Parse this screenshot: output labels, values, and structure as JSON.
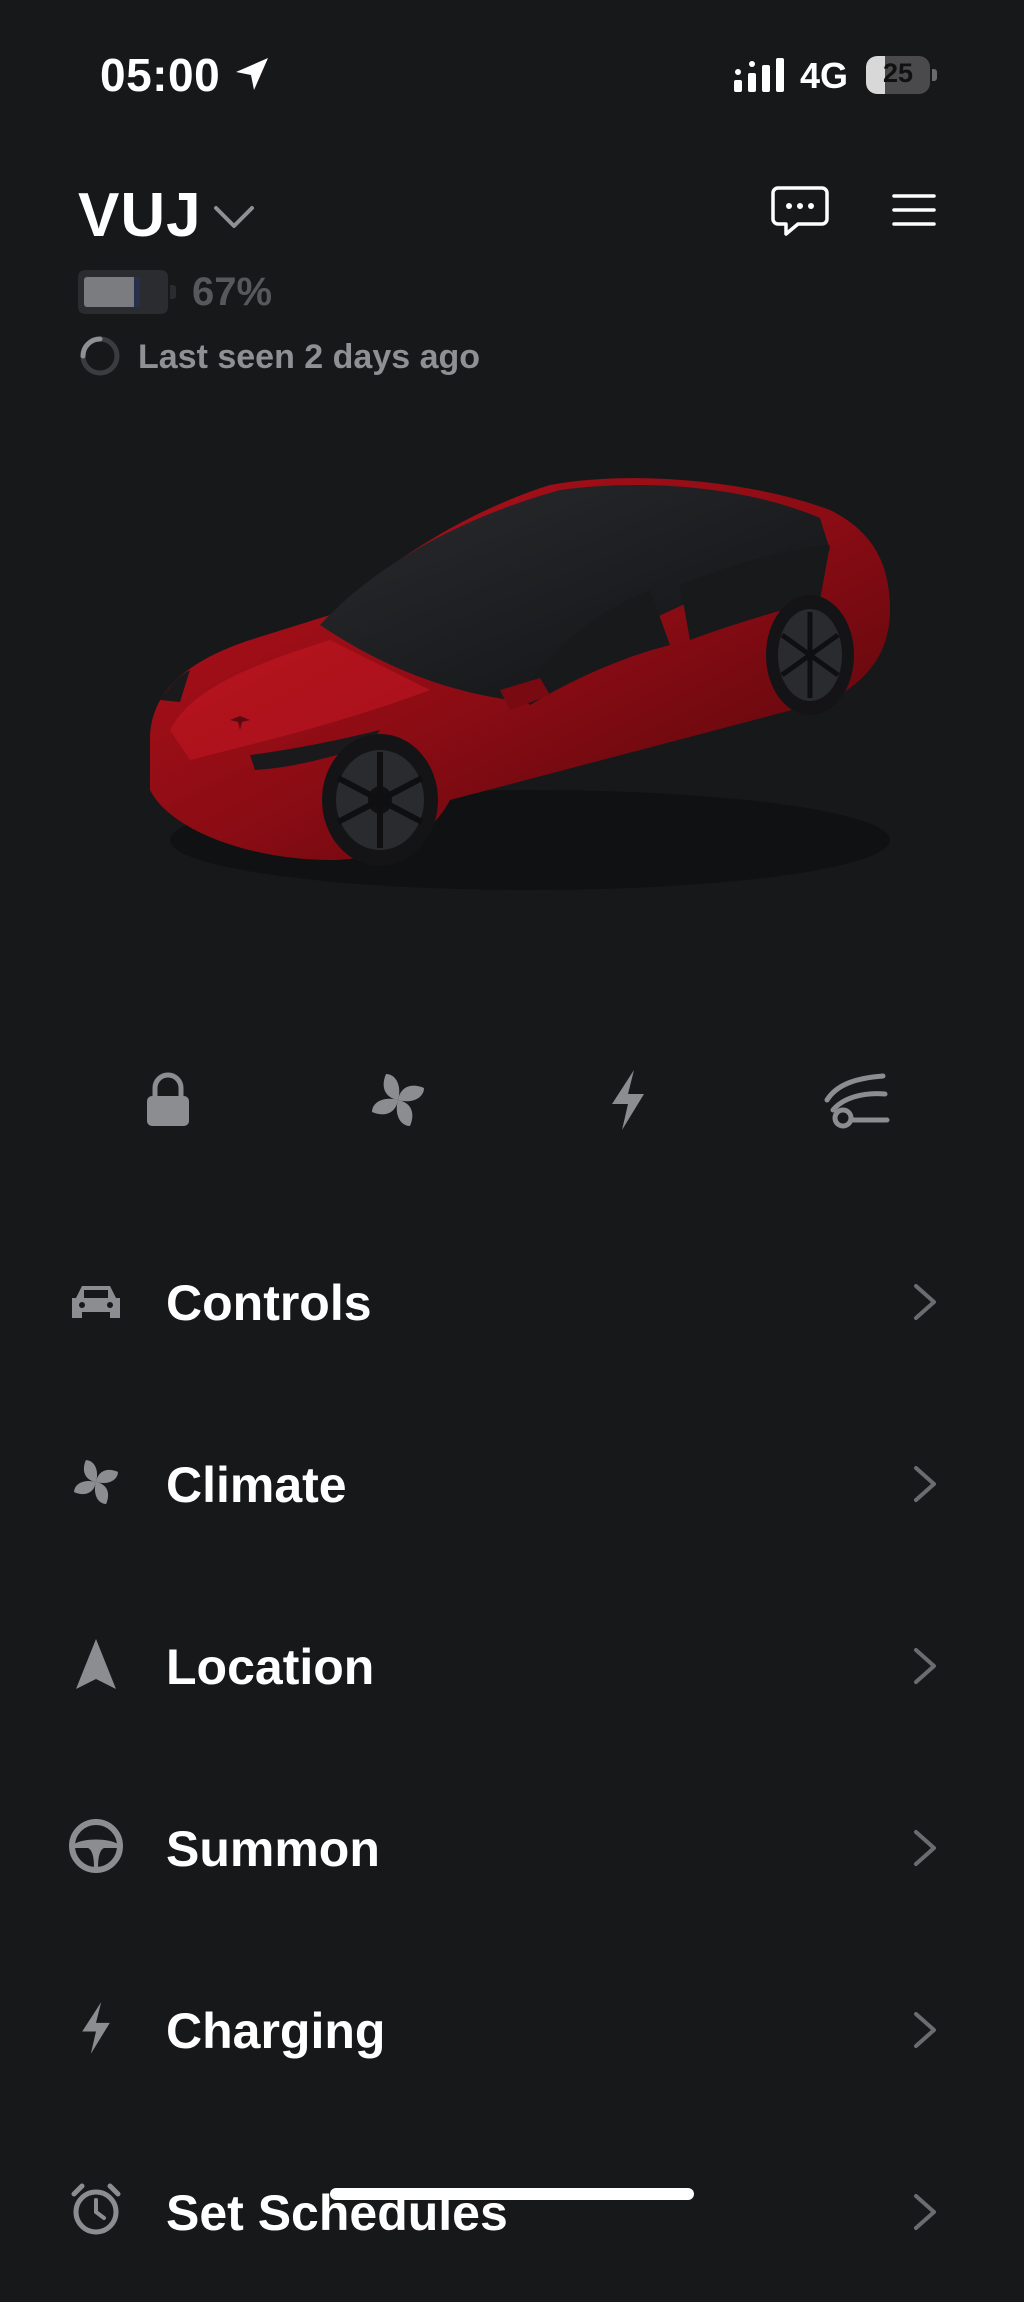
{
  "status_bar": {
    "time": "05:00",
    "network": "4G",
    "battery_level": "25"
  },
  "header": {
    "vehicle_name": "VUJ",
    "battery_percent": "67%",
    "last_seen": "Last seen 2 days ago"
  },
  "quick_actions": [
    "lock-icon",
    "fan-icon",
    "bolt-icon",
    "frunk-icon"
  ],
  "menu": [
    {
      "label": "Controls",
      "icon": "car-icon"
    },
    {
      "label": "Climate",
      "icon": "fan-icon"
    },
    {
      "label": "Location",
      "icon": "navigation-arrow-icon"
    },
    {
      "label": "Summon",
      "icon": "steering-wheel-icon"
    },
    {
      "label": "Charging",
      "icon": "bolt-icon"
    },
    {
      "label": "Set Schedules",
      "icon": "alarm-clock-icon"
    }
  ],
  "colors": {
    "background": "#17181a",
    "text_primary": "#ffffff",
    "text_muted": "#8e9094",
    "icon_gray": "#8b8d91",
    "car_body": "#a01018"
  }
}
